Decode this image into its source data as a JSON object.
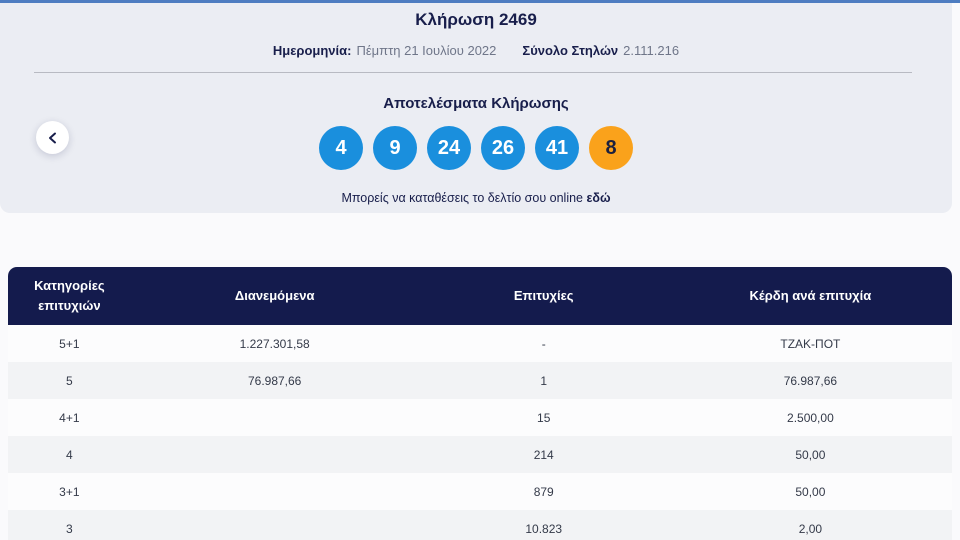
{
  "colors": {
    "accent_bar": "#4E7DC1",
    "hero_bg": "#EBEDF3",
    "ball_blue": "#1A8FDD",
    "ball_joker_orange": "#FAA21B",
    "table_header_navy": "#141B4D",
    "row_alt_gray": "#F2F3F5"
  },
  "hero": {
    "title": "Κλήρωση 2469",
    "date_label": "Ημερομηνία:",
    "date_value": "Πέμπτη 21 Ιουλίου 2022",
    "columns_label": "Σύνολο Στηλών",
    "columns_value": "2.111.216",
    "results_title": "Αποτελέσματα Κλήρωσης",
    "numbers": [
      {
        "value": "4",
        "type": "main"
      },
      {
        "value": "9",
        "type": "main"
      },
      {
        "value": "24",
        "type": "main"
      },
      {
        "value": "26",
        "type": "main"
      },
      {
        "value": "41",
        "type": "main"
      },
      {
        "value": "8",
        "type": "joker"
      }
    ],
    "note_text": "Μπορείς να καταθέσεις το δελτίο σου online",
    "note_link": "εδώ"
  },
  "table": {
    "headers": [
      "Κατηγορίες επιτυχιών",
      "Διανεμόμενα",
      "Επιτυχίες",
      "Κέρδη ανά επιτυχία"
    ],
    "rows": [
      {
        "category": "5+1",
        "distributed": "1.227.301,58",
        "winners": "-",
        "prize": "ΤΖΑΚ-ΠΟΤ"
      },
      {
        "category": "5",
        "distributed": "76.987,66",
        "winners": "1",
        "prize": "76.987,66"
      },
      {
        "category": "4+1",
        "distributed": "",
        "winners": "15",
        "prize": "2.500,00"
      },
      {
        "category": "4",
        "distributed": "",
        "winners": "214",
        "prize": "50,00"
      },
      {
        "category": "3+1",
        "distributed": "",
        "winners": "879",
        "prize": "50,00"
      },
      {
        "category": "3",
        "distributed": "",
        "winners": "10.823",
        "prize": "2,00"
      }
    ]
  }
}
